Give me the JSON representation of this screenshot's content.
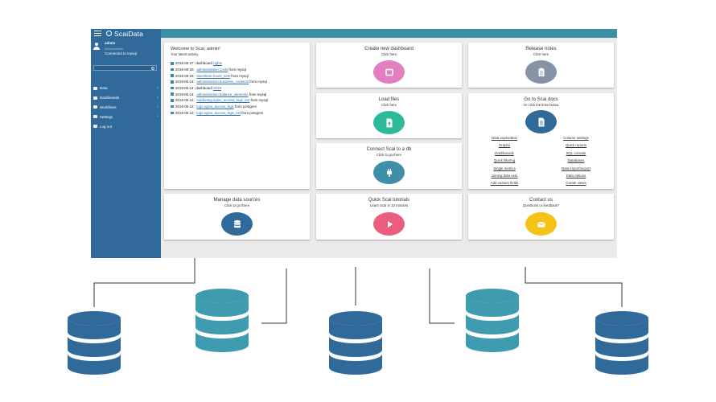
{
  "app": {
    "brand": "ScaiData",
    "user": {
      "name": "admin",
      "role": "Administrator",
      "connection": "Connected to mysql"
    },
    "search": {
      "placeholder": ""
    },
    "nav": [
      {
        "label": "Data",
        "icon": "database-icon"
      },
      {
        "label": "Dashboards",
        "icon": "dashboard-icon"
      },
      {
        "label": "Workflows",
        "icon": "workflow-icon"
      },
      {
        "label": "Settings",
        "icon": "settings-icon"
      },
      {
        "label": "Log out",
        "icon": "logout-icon"
      }
    ]
  },
  "welcome": {
    "title": "Welcome to Scai, admin!",
    "subtitle": "Your latest activity",
    "activity": [
      {
        "date": "2019-06-27:",
        "pre": "dashboard",
        "link": "rights",
        "post": ""
      },
      {
        "date": "2019-06-20:",
        "pre": "",
        "link": "administration.costs",
        "post": "from mysql"
      },
      {
        "date": "2019-06-19:",
        "pre": "",
        "link": "timesheet.hours_sets",
        "post": "from mysql"
      },
      {
        "date": "2019-06-14:",
        "pre": "",
        "link": "administration.business_contacts",
        "post": "from mysql"
      },
      {
        "date": "2019-06-14:",
        "pre": "dashboard",
        "link": "2019",
        "post": ""
      },
      {
        "date": "2019-06-14:",
        "pre": "",
        "link": "administration.balance_elements",
        "post": "from mysql"
      },
      {
        "date": "2019-06-12:",
        "pre": "",
        "link": "marketing.nginx_access_logs_ext",
        "post": "from mysql"
      },
      {
        "date": "2019-06-12:",
        "pre": "",
        "link": "logs.nginx_access_logs",
        "post": "from postgres"
      },
      {
        "date": "2019-06-12:",
        "pre": "",
        "link": "logs.nginx_access_logs_ext",
        "post": "from postgres"
      }
    ]
  },
  "cards": {
    "create_dashboard": {
      "title": "Create new dashboard",
      "subtitle": "Click here",
      "color": "#e37fc1",
      "icon": "dashboard-window-icon"
    },
    "release_notes": {
      "title": "Release notes",
      "subtitle": "Click here",
      "color": "#8693a6",
      "icon": "clipboard-icon"
    },
    "load_files": {
      "title": "Load files",
      "subtitle": "Click here",
      "color": "#2dba9a",
      "icon": "file-upload-icon"
    },
    "scai_docs": {
      "title": "Go to Scai docs",
      "subtitle": "Or click the links below",
      "color": "#2f6a9b",
      "icon": "document-icon"
    },
    "connect_db": {
      "title": "Connect Scai to a db",
      "subtitle": "Click to go there",
      "color": "#3f8fa8",
      "icon": "plug-icon"
    },
    "manage_sources": {
      "title": "Manage data sources",
      "subtitle": "Click to go there",
      "color": "#2f6a9b",
      "icon": "database-icon"
    },
    "tutorials": {
      "title": "Quick Scai tutorials",
      "subtitle": "Learn Scai in 10 minutes",
      "color": "#ec5d7d",
      "icon": "play-icon"
    },
    "contact": {
      "title": "Contact us",
      "subtitle": "Questions or feedback?",
      "color": "#f5c318",
      "icon": "envelope-icon"
    }
  },
  "doc_links": {
    "left": [
      "Data exploration",
      "Graphs",
      "Dashboards",
      "Quick filtering",
      "Single metrics",
      "Joining data sets",
      "Add custom fields"
    ],
    "right": [
      "Column settings",
      "Quick reports",
      "SQL console",
      "Databases",
      "Data import/export",
      "Data options",
      "Create views"
    ]
  },
  "diagram": {
    "db_colors": [
      "#2f6a9b",
      "#3f9bb0"
    ]
  }
}
